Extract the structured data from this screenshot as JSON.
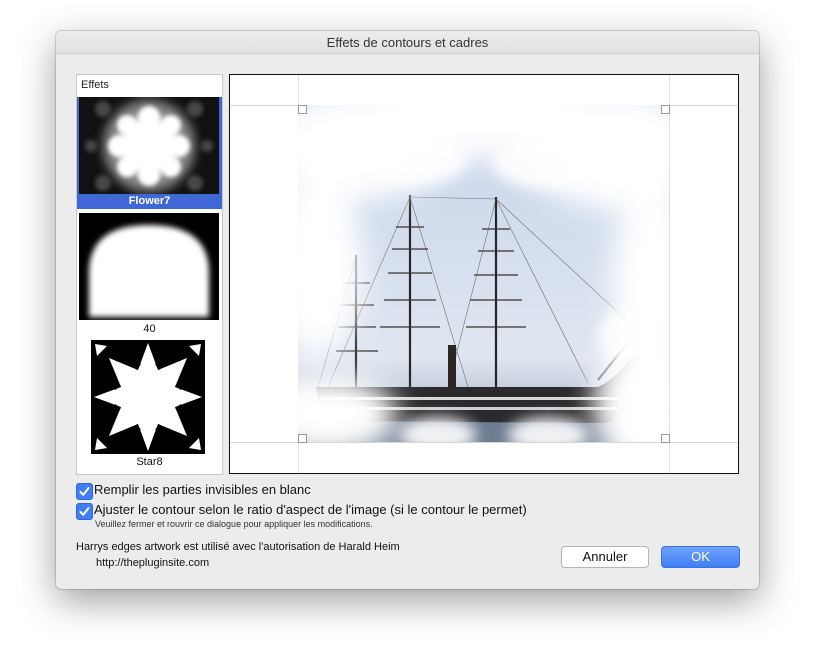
{
  "window": {
    "title": "Effets de contours et cadres"
  },
  "effects": {
    "header": "Effets",
    "items": [
      {
        "label": "Flower7",
        "selected": true
      },
      {
        "label": "40",
        "selected": false
      },
      {
        "label": "Star8",
        "selected": false
      }
    ]
  },
  "options": {
    "fill_invisible": {
      "label": "Remplir les parties invisibles en blanc",
      "checked": true
    },
    "adjust_ratio": {
      "label": "Ajuster le contour selon le ratio d'aspect de l'image (si le contour le permet)",
      "checked": true
    },
    "hint": "Veuillez fermer et rouvrir ce dialogue pour appliquer les modifications."
  },
  "credits": {
    "line1": "Harrys edges artwork est utilisé avec l'autorisation de Harald Heim",
    "url": "http://thepluginsite.com"
  },
  "buttons": {
    "cancel": "Annuler",
    "ok": "OK"
  },
  "colors": {
    "selection": "#3f68d6",
    "accent": "#3f7ef4"
  }
}
